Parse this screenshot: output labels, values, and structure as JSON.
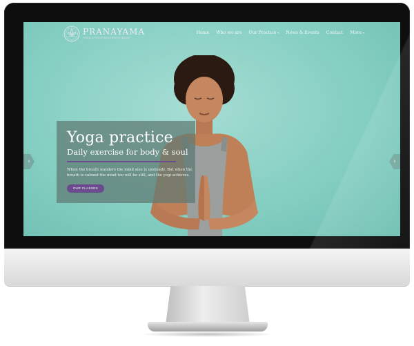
{
  "site": {
    "brand": "PRANAYAMA",
    "tagline": "YOGA STUDIO MULTIPAGE DEMO"
  },
  "nav": {
    "items": [
      {
        "label": "Home"
      },
      {
        "label": "Who we are"
      },
      {
        "label": "Our Practice",
        "has_dropdown": true
      },
      {
        "label": "News & Events"
      },
      {
        "label": "Contact"
      },
      {
        "label": "More",
        "has_dropdown": true
      }
    ],
    "caret": "▾"
  },
  "hero": {
    "title": "Yoga practice",
    "subtitle": "Daily exercise for body & soul",
    "text": "When the breath wanders the mind also is unsteady. But when the breath is calmed the mind too will be still, and the yogi achieves.",
    "cta_label": "OUR CLASSES"
  },
  "slider": {
    "prev_icon": "‹",
    "next_icon": "›"
  },
  "colors": {
    "accent": "#6b4a8e",
    "screen_background": "#86cfc3",
    "overlay": "#5e7872"
  }
}
